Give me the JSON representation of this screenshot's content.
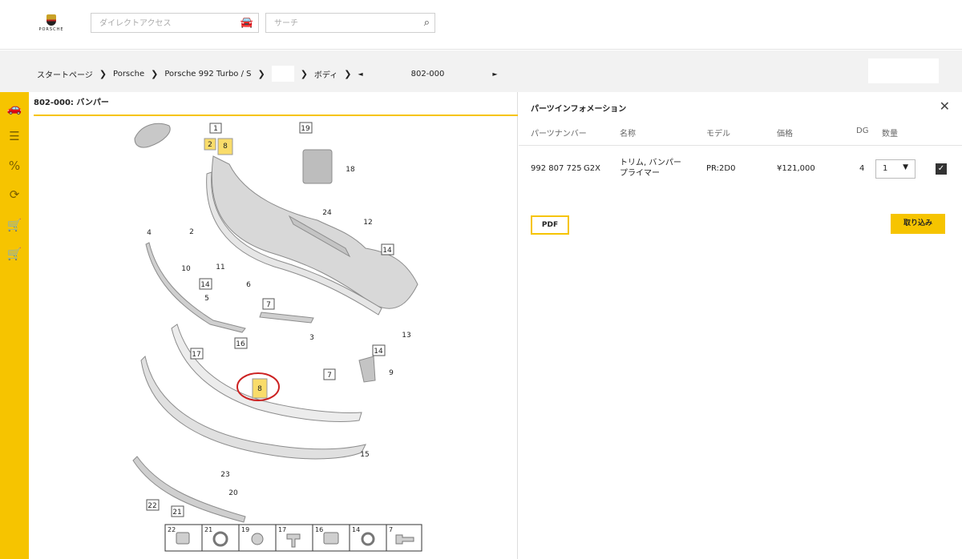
{
  "header": {
    "logo_text": "PORSCHE",
    "direct_access_placeholder": "ダイレクトアクセス",
    "search_placeholder": "サーチ"
  },
  "breadcrumb": {
    "items": [
      "スタートページ",
      "Porsche",
      "Porsche 992 Turbo / S",
      "ボディ",
      "802-000"
    ],
    "prev_label": "◄",
    "next_label": "►"
  },
  "diagram": {
    "title": "802-000: バンパー",
    "callouts": [
      "1",
      "2",
      "8",
      "18",
      "19",
      "24",
      "12",
      "14",
      "4",
      "2",
      "10",
      "11",
      "14",
      "6",
      "5",
      "7",
      "3",
      "13",
      "14",
      "16",
      "17",
      "7",
      "9",
      "8",
      "15",
      "23",
      "20",
      "22",
      "21"
    ],
    "legend": [
      "22",
      "21",
      "19",
      "17",
      "16",
      "14",
      "7"
    ]
  },
  "parts_info": {
    "title": "パーツインフォメーション",
    "columns": [
      "パーツナンバー",
      "名称",
      "モデル",
      "価格",
      "DG",
      "数量"
    ],
    "rows": [
      {
        "part_number": "992 807 725",
        "suffix": "G2X",
        "name_line1": "トリム, バンパー",
        "name_line2": "プライマー",
        "model": "PR:2D0",
        "price": "¥121,000",
        "dg": "4",
        "quantity": "1"
      }
    ],
    "pdf_label": "PDF",
    "import_label": "取り込み"
  },
  "colors": {
    "accent": "#f6c400",
    "highlight_circle": "#cc2222",
    "callout_highlight": "#f9dc6a"
  }
}
